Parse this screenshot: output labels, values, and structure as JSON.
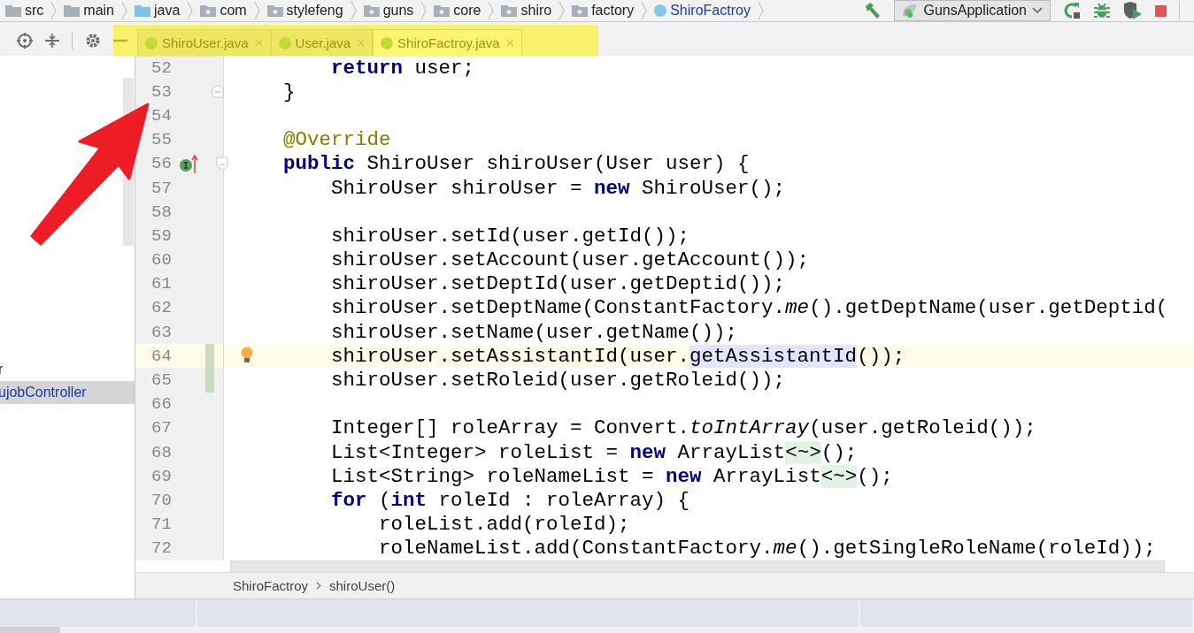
{
  "breadcrumb": [
    {
      "label": "src",
      "kind": "folder"
    },
    {
      "label": "main",
      "kind": "folder"
    },
    {
      "label": "java",
      "kind": "source"
    },
    {
      "label": "com",
      "kind": "package"
    },
    {
      "label": "stylefeng",
      "kind": "package"
    },
    {
      "label": "guns",
      "kind": "package"
    },
    {
      "label": "core",
      "kind": "package"
    },
    {
      "label": "shiro",
      "kind": "package"
    },
    {
      "label": "factory",
      "kind": "package"
    },
    {
      "label": "ShiroFactroy",
      "kind": "class"
    }
  ],
  "run_toolbar": {
    "configuration": "GunsApplication"
  },
  "project_panel": {
    "items": [
      {
        "label": "r",
        "selected": false
      },
      {
        "label": "ujobController",
        "selected": true
      }
    ]
  },
  "tabs": [
    {
      "label": "ShiroUser.java",
      "selected": false
    },
    {
      "label": "User.java",
      "selected": false
    },
    {
      "label": "ShiroFactroy.java",
      "selected": true
    }
  ],
  "editor": {
    "lines": [
      {
        "number": "52",
        "tokens": [
          {
            "text": "        return",
            "kind": "keyword"
          },
          {
            "text": " user;",
            "kind": "plain"
          }
        ]
      },
      {
        "number": "53",
        "fold_end": true,
        "tokens": [
          {
            "text": "    }",
            "kind": "plain"
          }
        ]
      },
      {
        "number": "54"
      },
      {
        "number": "55",
        "tokens": [
          {
            "text": "    @Override",
            "kind": "annotation"
          }
        ]
      },
      {
        "number": "56",
        "fold_start": true,
        "implements_marker": true,
        "tokens": [
          {
            "text": "    public",
            "kind": "keyword"
          },
          {
            "text": " ShiroUser shiroUser(User user) {",
            "kind": "plain"
          }
        ]
      },
      {
        "number": "57",
        "tokens": [
          {
            "text": "        ShiroUser shiroUser = ",
            "kind": "plain"
          },
          {
            "text": "new",
            "kind": "keyword"
          },
          {
            "text": " ShiroUser();",
            "kind": "plain"
          }
        ]
      },
      {
        "number": "58"
      },
      {
        "number": "59",
        "tokens": [
          {
            "text": "        shiroUser.setId(user.getId());",
            "kind": "plain"
          }
        ]
      },
      {
        "number": "60",
        "tokens": [
          {
            "text": "        shiroUser.setAccount(user.getAccount());",
            "kind": "plain"
          }
        ]
      },
      {
        "number": "61",
        "tokens": [
          {
            "text": "        shiroUser.setDeptId(user.getDeptid());",
            "kind": "plain"
          }
        ]
      },
      {
        "number": "62",
        "tokens": [
          {
            "text": "        shiroUser.setDeptName(ConstantFactory.",
            "kind": "plain"
          },
          {
            "text": "me",
            "kind": "static"
          },
          {
            "text": "().getDeptName(user.getDeptid(",
            "kind": "plain"
          }
        ]
      },
      {
        "number": "63",
        "tokens": [
          {
            "text": "        shiroUser.setName(user.getName());",
            "kind": "plain"
          }
        ]
      },
      {
        "number": "64",
        "current": true,
        "changed": true,
        "intention": true,
        "tokens": [
          {
            "text": "        shiroUser.setAssistantId(user.",
            "kind": "plain"
          },
          {
            "text": "getAssistantId",
            "kind": "highlight"
          },
          {
            "text": "());",
            "kind": "plain"
          }
        ]
      },
      {
        "number": "65",
        "changed": true,
        "tokens": [
          {
            "text": "        shiroUser.setRoleid(user.getRoleid());",
            "kind": "plain"
          }
        ]
      },
      {
        "number": "66"
      },
      {
        "number": "67",
        "tokens": [
          {
            "text": "        Integer[] roleArray = Convert.",
            "kind": "plain"
          },
          {
            "text": "toIntArray",
            "kind": "static"
          },
          {
            "text": "(user.getRoleid());",
            "kind": "plain"
          }
        ]
      },
      {
        "number": "68",
        "tokens": [
          {
            "text": "        List<Integer> roleList = ",
            "kind": "plain"
          },
          {
            "text": "new",
            "kind": "keyword"
          },
          {
            "text": " ArrayList",
            "kind": "plain"
          },
          {
            "text": "<~>",
            "kind": "fold"
          },
          {
            "text": "();",
            "kind": "plain"
          }
        ]
      },
      {
        "number": "69",
        "tokens": [
          {
            "text": "        List<String> roleNameList = ",
            "kind": "plain"
          },
          {
            "text": "new",
            "kind": "keyword"
          },
          {
            "text": " ArrayList",
            "kind": "plain"
          },
          {
            "text": "<~>",
            "kind": "fold"
          },
          {
            "text": "();",
            "kind": "plain"
          }
        ]
      },
      {
        "number": "70",
        "tokens": [
          {
            "text": "        for",
            "kind": "keyword"
          },
          {
            "text": " (",
            "kind": "plain"
          },
          {
            "text": "int",
            "kind": "keyword"
          },
          {
            "text": " roleId : roleArray) {",
            "kind": "plain"
          }
        ]
      },
      {
        "number": "71",
        "tokens": [
          {
            "text": "            roleList.add(roleId);",
            "kind": "plain"
          }
        ]
      },
      {
        "number": "72",
        "tokens": [
          {
            "text": "            roleNameList.add(ConstantFactory.",
            "kind": "plain"
          },
          {
            "text": "me",
            "kind": "static"
          },
          {
            "text": "().getSingleRoleName(roleId));",
            "kind": "plain"
          }
        ]
      }
    ]
  },
  "navigation_bar": [
    {
      "label": "ShiroFactroy"
    },
    {
      "label": "shiroUser()"
    }
  ]
}
